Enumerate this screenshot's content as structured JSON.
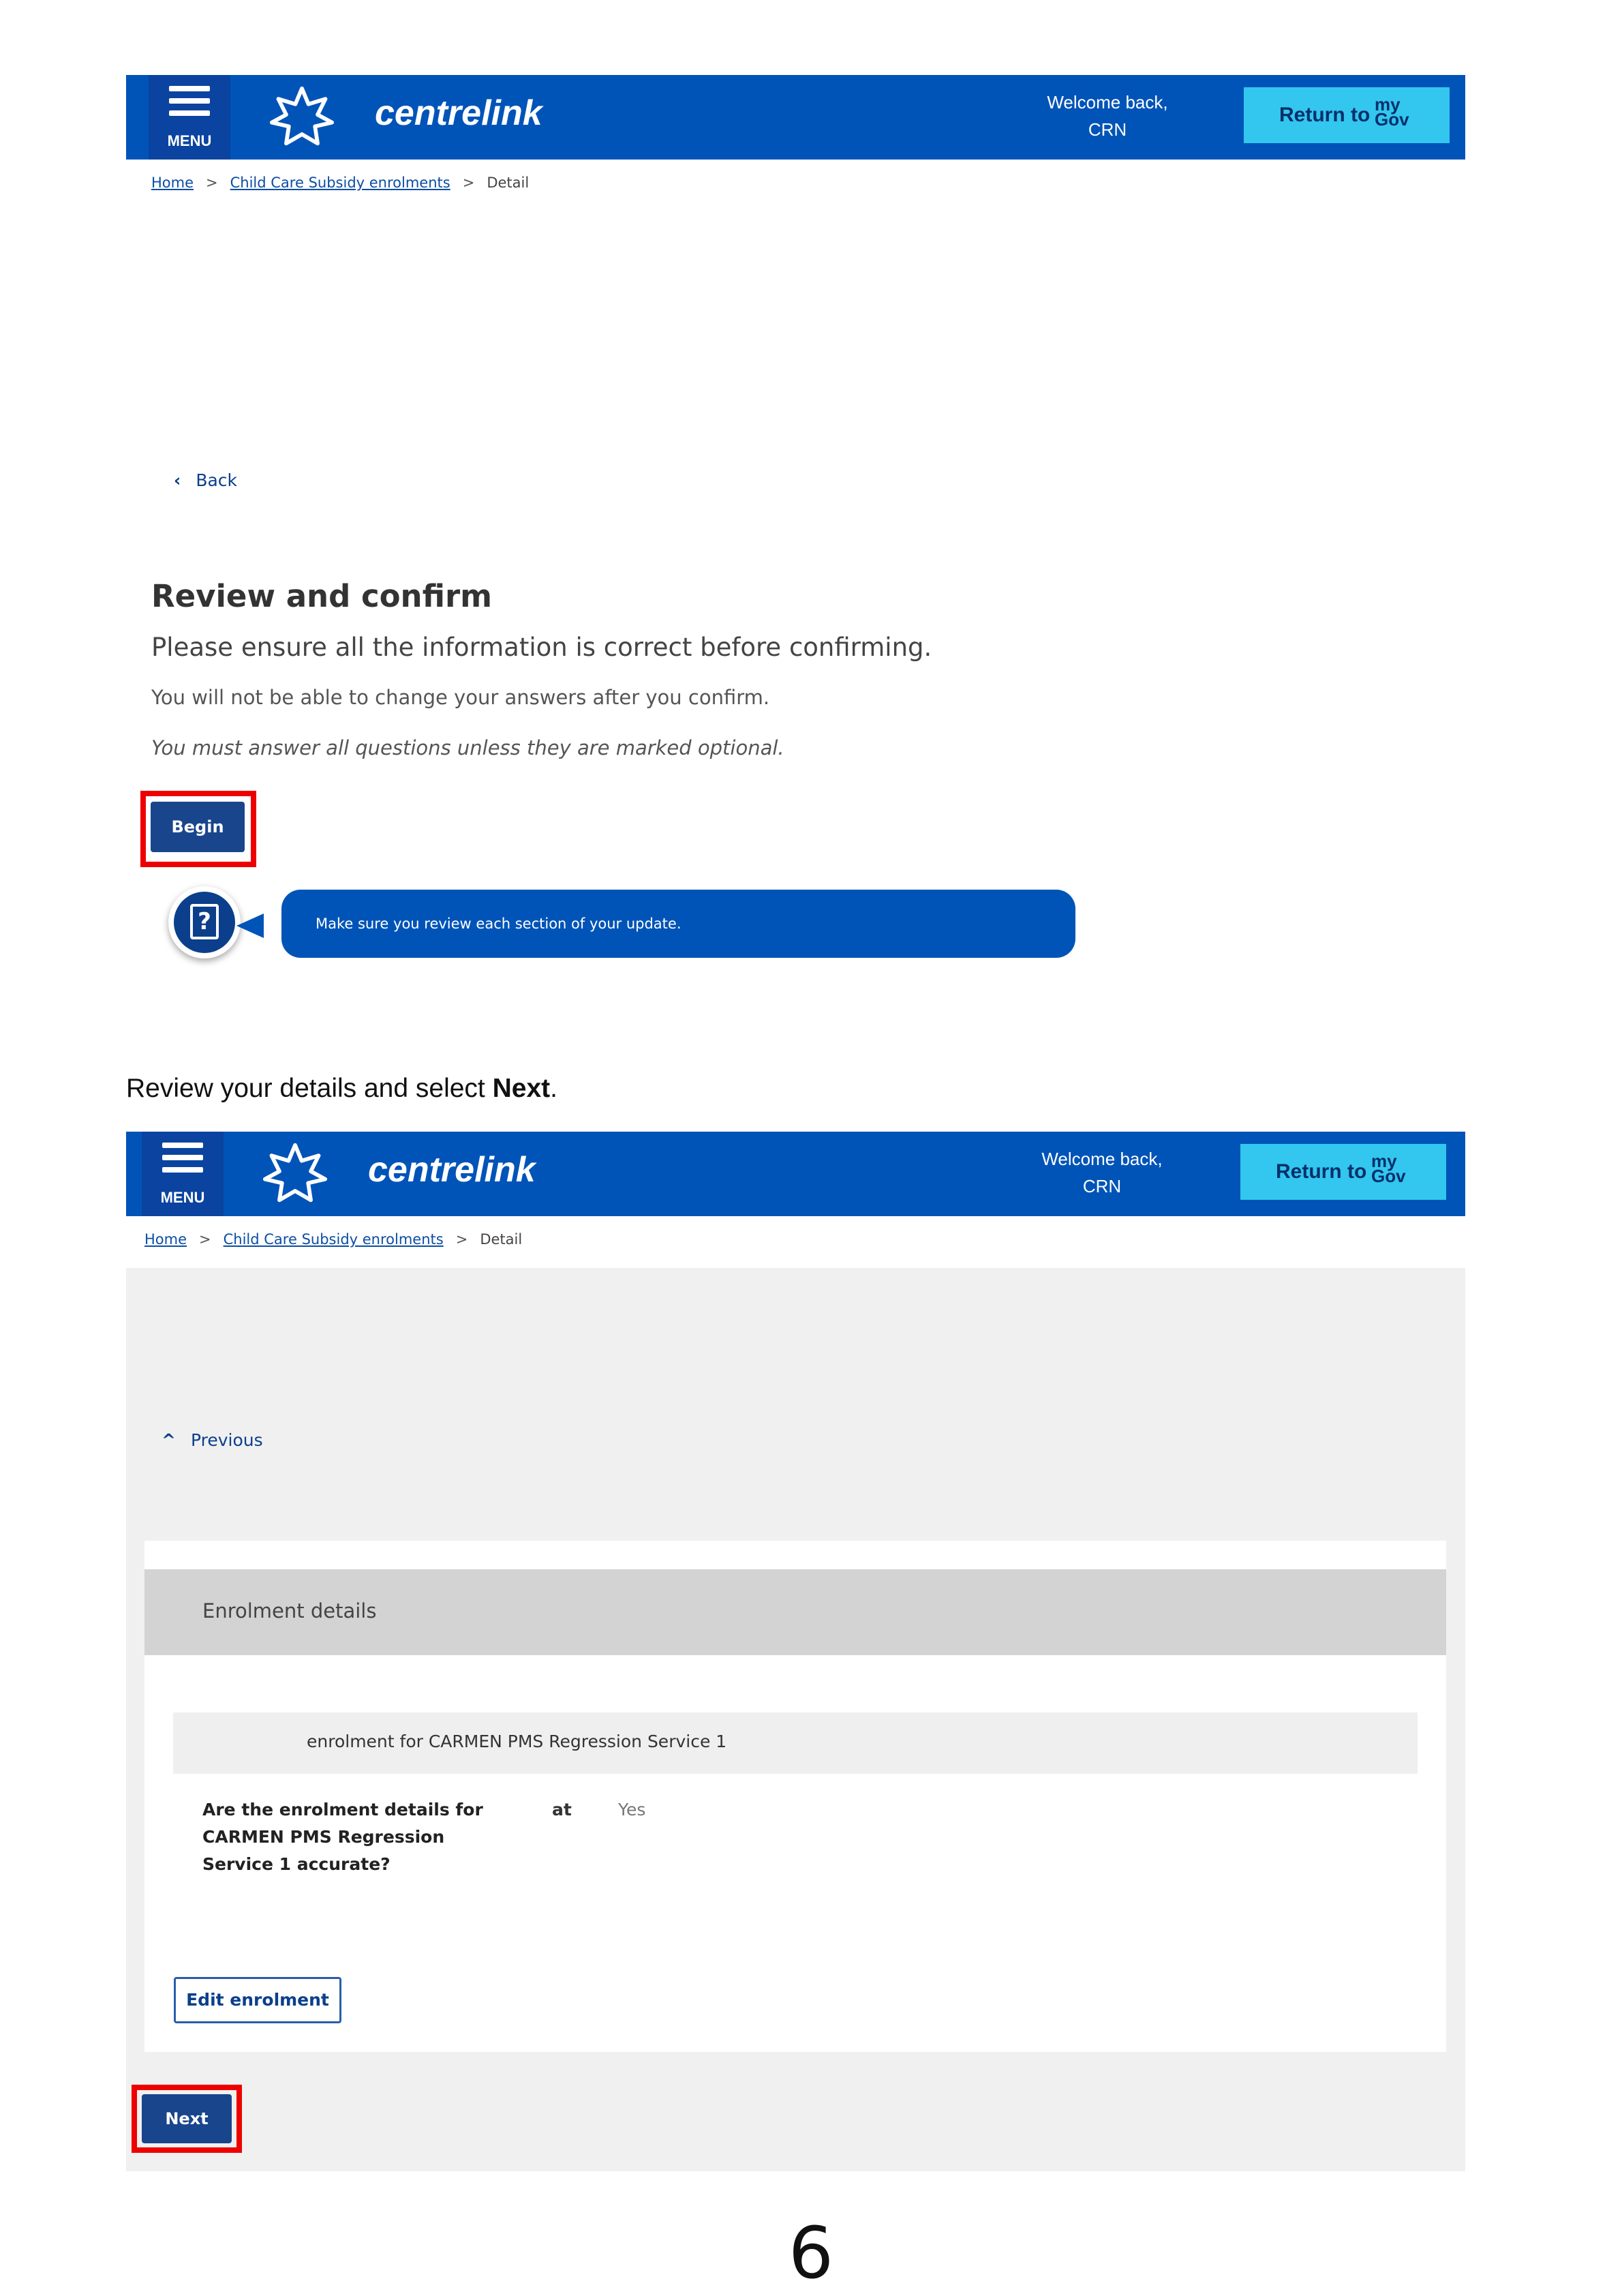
{
  "header": {
    "menu_label": "MENU",
    "logo_text": "centrelink",
    "welcome_line1": "Welcome back,",
    "welcome_line2": "CRN",
    "return_label": "Return to",
    "mygov_top": "my",
    "mygov_bottom": "Gov",
    "brand_color": "#0054b8",
    "accent_color": "#33c6ef"
  },
  "breadcrumb": {
    "home": "Home",
    "middle": "Child Care Subsidy enrolments",
    "current": "Detail",
    "separator": ">"
  },
  "screen1": {
    "back_label": "Back",
    "heading": "Review and confirm",
    "subheading": "Please ensure all the information is correct before confirming.",
    "note": "You will not be able to change your answers after you confirm.",
    "note_italic": "You must answer all questions unless they are marked optional.",
    "begin_label": "Begin",
    "help_message": "Make sure you review each section of your update.",
    "help_icon": "question-book-icon"
  },
  "instruction": {
    "text": "Review your details and select ",
    "bold": "Next",
    "end": "."
  },
  "screen2": {
    "previous_label": "Previous",
    "card_title": "Enrolment details",
    "sub_title": "enrolment for CARMEN PMS Regression Service 1",
    "question": "Are the enrolment details for CARMEN PMS Regression Service 1 accurate?",
    "at_label": "at",
    "answer": "Yes",
    "edit_label": "Edit enrolment",
    "next_label": "Next"
  },
  "highlight_color": "#ee0000",
  "page_number": "6"
}
